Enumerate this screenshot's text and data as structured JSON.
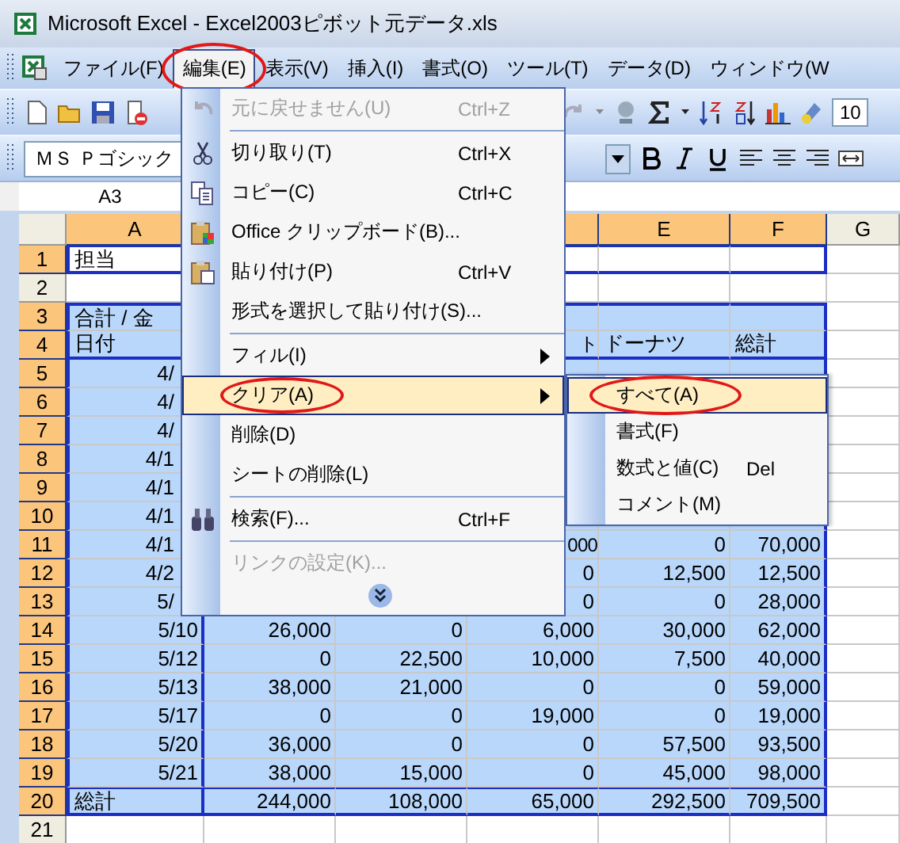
{
  "window": {
    "title": "Microsoft Excel - Excel2003ピボット元データ.xls"
  },
  "menu_bar": [
    {
      "label": "ファイル(F)",
      "selected": false,
      "circled": false
    },
    {
      "label": "編集(E)",
      "selected": true,
      "circled": true
    },
    {
      "label": "表示(V)",
      "selected": false,
      "circled": false
    },
    {
      "label": "挿入(I)",
      "selected": false,
      "circled": false
    },
    {
      "label": "書式(O)",
      "selected": false,
      "circled": false
    },
    {
      "label": "ツール(T)",
      "selected": false,
      "circled": false
    },
    {
      "label": "データ(D)",
      "selected": false,
      "circled": false
    },
    {
      "label": "ウィンドウ(W",
      "selected": false,
      "circled": false
    }
  ],
  "standard_toolbar": {
    "zoom": "10"
  },
  "format_toolbar": {
    "font": "ＭＳ Ｐゴシック"
  },
  "name_box": "A3",
  "sheet": {
    "columns": [
      {
        "label": "A",
        "selected": true
      },
      {
        "selected": true
      },
      {
        "label": "E",
        "selected": true
      },
      {
        "label": "F",
        "selected": true
      },
      {
        "label": "G",
        "selected": false
      }
    ],
    "rows": [
      {
        "header": "1",
        "selected": true,
        "kind": "filter",
        "a": "担当"
      },
      {
        "header": "2",
        "selected": false,
        "kind": "blank"
      },
      {
        "header": "3",
        "selected": true,
        "kind": "title",
        "a": "合計 / 金"
      },
      {
        "header": "4",
        "selected": true,
        "kind": "heading",
        "a": "日付",
        "d": {
          "text": "ト",
          "covered": true
        },
        "e": "ドーナツ",
        "f": "総計"
      },
      {
        "header": "5",
        "selected": true,
        "kind": "data",
        "a": {
          "text": "4/",
          "covered": true
        }
      },
      {
        "header": "6",
        "selected": true,
        "kind": "data",
        "a": {
          "text": "4/",
          "covered": true
        }
      },
      {
        "header": "7",
        "selected": true,
        "kind": "data",
        "a": {
          "text": "4/",
          "covered": true
        }
      },
      {
        "header": "8",
        "selected": true,
        "kind": "data",
        "a": {
          "text": "4/1",
          "covered": true
        }
      },
      {
        "header": "9",
        "selected": true,
        "kind": "data",
        "a": {
          "text": "4/1",
          "covered": true
        }
      },
      {
        "header": "10",
        "selected": true,
        "kind": "data",
        "a": {
          "text": "4/1",
          "covered": true
        }
      },
      {
        "header": "11",
        "selected": true,
        "kind": "data",
        "a": {
          "text": "4/1",
          "covered": true
        },
        "d": {
          "text": "000",
          "covered": true
        },
        "e": "0",
        "f": "70,000"
      },
      {
        "header": "12",
        "selected": true,
        "kind": "data",
        "a": {
          "text": "4/2",
          "covered": true
        },
        "d": "0",
        "e": "12,500",
        "f": "12,500"
      },
      {
        "header": "13",
        "selected": true,
        "kind": "data",
        "a": {
          "text": "5/",
          "covered": true
        },
        "d": "0",
        "e": "0",
        "f": "28,000"
      },
      {
        "header": "14",
        "selected": true,
        "kind": "data",
        "a": "5/10",
        "b": "26,000",
        "c": "0",
        "d": "6,000",
        "e": "30,000",
        "f": "62,000"
      },
      {
        "header": "15",
        "selected": true,
        "kind": "data",
        "a": "5/12",
        "b": "0",
        "c": "22,500",
        "d": "10,000",
        "e": "7,500",
        "f": "40,000"
      },
      {
        "header": "16",
        "selected": true,
        "kind": "data",
        "a": "5/13",
        "b": "38,000",
        "c": "21,000",
        "d": "0",
        "e": "0",
        "f": "59,000"
      },
      {
        "header": "17",
        "selected": true,
        "kind": "data",
        "a": "5/17",
        "b": "0",
        "c": "0",
        "d": "19,000",
        "e": "0",
        "f": "19,000"
      },
      {
        "header": "18",
        "selected": true,
        "kind": "data",
        "a": "5/20",
        "b": "36,000",
        "c": "0",
        "d": "0",
        "e": "57,500",
        "f": "93,500"
      },
      {
        "header": "19",
        "selected": true,
        "kind": "data",
        "a": "5/21",
        "b": "38,000",
        "c": "15,000",
        "d": "0",
        "e": "45,000",
        "f": "98,000"
      },
      {
        "header": "20",
        "selected": true,
        "kind": "total",
        "a": "総計",
        "b": "244,000",
        "c": "108,000",
        "d": "65,000",
        "e": "292,500",
        "f": "709,500"
      },
      {
        "header": "21",
        "selected": false,
        "kind": "blank"
      }
    ]
  },
  "edit_menu": {
    "items": [
      {
        "kind": "command",
        "label": "元に戻せません(U)",
        "shortcut": "Ctrl+Z",
        "disabled": true,
        "selected": false,
        "circled": false
      },
      {
        "kind": "separator"
      },
      {
        "kind": "command",
        "label": "切り取り(T)",
        "shortcut": "Ctrl+X",
        "disabled": false,
        "selected": false,
        "circled": false
      },
      {
        "kind": "command",
        "label": "コピー(C)",
        "shortcut": "Ctrl+C",
        "disabled": false,
        "selected": false,
        "circled": false
      },
      {
        "kind": "command",
        "label": "Office クリップボード(B)...",
        "disabled": false,
        "selected": false,
        "circled": false
      },
      {
        "kind": "command",
        "label": "貼り付け(P)",
        "shortcut": "Ctrl+V",
        "disabled": false,
        "selected": false,
        "circled": false
      },
      {
        "kind": "command",
        "label": "形式を選択して貼り付け(S)...",
        "disabled": false,
        "selected": false,
        "circled": false
      },
      {
        "kind": "separator"
      },
      {
        "kind": "submenu",
        "label": "フィル(I)",
        "disabled": false,
        "selected": false,
        "circled": false
      },
      {
        "kind": "submenu",
        "label": "クリア(A)",
        "disabled": false,
        "selected": true,
        "circled": true
      },
      {
        "kind": "command",
        "label": "削除(D)",
        "disabled": false,
        "selected": false,
        "circled": false
      },
      {
        "kind": "command",
        "label": "シートの削除(L)",
        "disabled": false,
        "selected": false,
        "circled": false
      },
      {
        "kind": "separator"
      },
      {
        "kind": "command",
        "label": "検索(F)...",
        "shortcut": "Ctrl+F",
        "disabled": false,
        "selected": false,
        "circled": false
      },
      {
        "kind": "separator"
      },
      {
        "kind": "command",
        "label": "リンクの設定(K)...",
        "disabled": true,
        "selected": false,
        "circled": false
      },
      {
        "kind": "expand"
      }
    ]
  },
  "clear_submenu": {
    "items": [
      {
        "label": "すべて(A)",
        "selected": true,
        "circled": true
      },
      {
        "label": "書式(F)",
        "selected": false,
        "circled": false
      },
      {
        "label": "数式と値(C)",
        "shortcut": "Del",
        "selected": false,
        "circled": false
      },
      {
        "label": "コメント(M)",
        "selected": false,
        "circled": false
      }
    ]
  }
}
